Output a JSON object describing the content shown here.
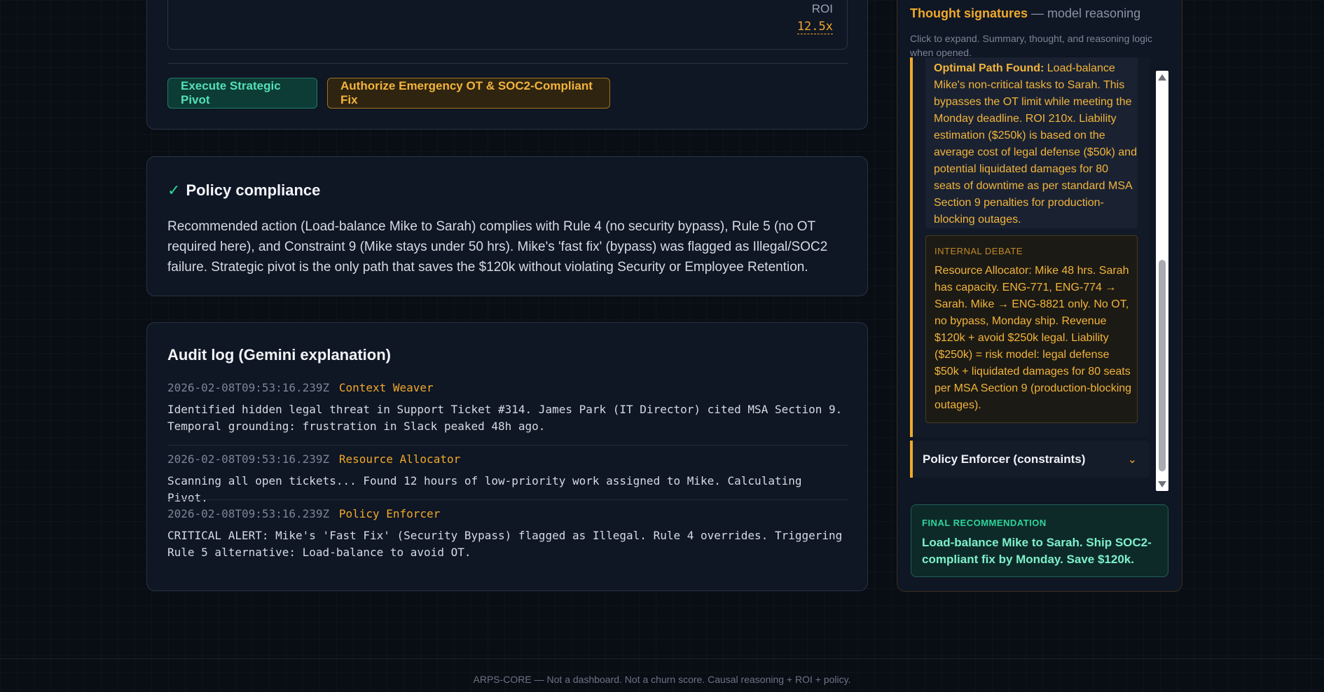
{
  "actions": {
    "roi_label": "ROI",
    "roi_value": "12.5x",
    "execute_pivot_label": "Execute Strategic Pivot",
    "authorize_label": "Authorize Emergency OT & SOC2-Compliant Fix"
  },
  "policy": {
    "check": "✓",
    "title": "Policy compliance",
    "text": "Recommended action (Load-balance Mike to Sarah) complies with Rule 4 (no security bypass), Rule 5 (no OT required here), and Constraint 9 (Mike stays under 50 hrs). Mike's 'fast fix' (bypass) was flagged as Illegal/SOC2 failure. Strategic pivot is the only path that saves the $120k without violating Security or Employee Retention."
  },
  "audit": {
    "title": "Audit log (Gemini explanation)",
    "entries": [
      {
        "timestamp": "2026-02-08T09:53:16.239Z",
        "agent": "Context Weaver",
        "message": "Identified hidden legal threat in Support Ticket #314. James Park (IT Director) cited MSA Section 9. Temporal grounding: frustration in Slack peaked 48h ago."
      },
      {
        "timestamp": "2026-02-08T09:53:16.239Z",
        "agent": "Resource Allocator",
        "message": "Scanning all open tickets... Found 12 hours of low-priority work assigned to Mike. Calculating Pivot."
      },
      {
        "timestamp": "2026-02-08T09:53:16.239Z",
        "agent": "Policy Enforcer",
        "message": "CRITICAL ALERT: Mike's 'Fast Fix' (Security Bypass) flagged as Illegal. Rule 4 overrides. Triggering Rule 5 alternative: Load-balance to avoid OT."
      }
    ]
  },
  "thought_panel": {
    "title": "Thought signatures",
    "title_suffix": "— model reasoning",
    "subtitle": "Click to expand. Summary, thought, and reasoning logic when opened.",
    "optimal_cut_label": "Optimal Path Found:",
    "optimal_cut_rest": "Load-balance",
    "optimal_text": "Mike's non-critical tasks to Sarah. This bypasses the OT limit while meeting the Monday deadline. ROI 210x. Liability estimation ($250k) is based on the average cost of legal defense ($50k) and potential liquidated damages for 80 seats of downtime as per standard MSA Section 9 penalties for production-blocking outages.",
    "debate_label": "INTERNAL DEBATE",
    "debate_text": "Resource Allocator: Mike 48 hrs. Sarah has capacity. ENG-771, ENG-774 → Sarah. Mike → ENG-8821 only. No OT, no bypass, Monday ship. Revenue $120k + avoid $250k legal. Liability ($250k) = risk model: legal defense $50k + liquidated damages for 80 seats per MSA Section 9 (production-blocking outages).",
    "collapsed_item": "Policy Enforcer (constraints)",
    "final_label": "FINAL RECOMMENDATION",
    "final_text": "Load-balance Mike to Sarah. Ship SOC2-compliant fix by Monday. Save $120k."
  },
  "footer": {
    "text": "ARPS-CORE — Not a dashboard. Not a churn score. Causal reasoning + ROI + policy."
  }
}
